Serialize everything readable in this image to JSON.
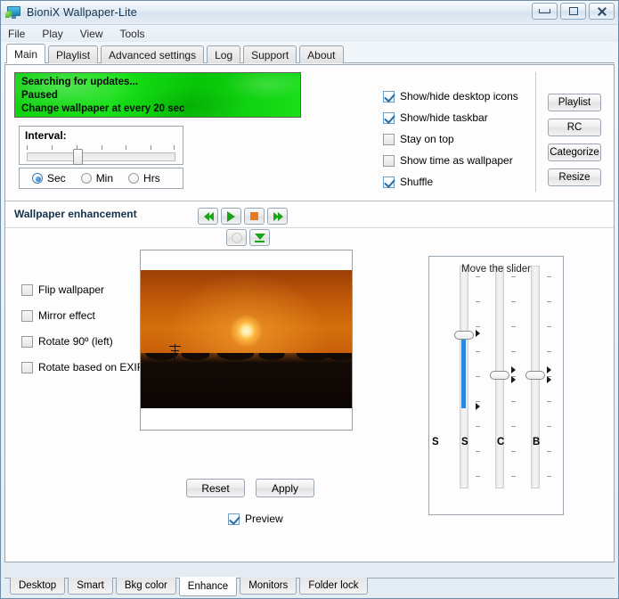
{
  "window": {
    "title": "BioniX Wallpaper-Lite",
    "icon": "monitor-leaf-icon",
    "controls": {
      "minimize": "minimize-icon",
      "maximize": "restore-icon",
      "close": "close-icon"
    }
  },
  "menu": {
    "items": [
      {
        "label": "File"
      },
      {
        "label": "Play"
      },
      {
        "label": "View"
      },
      {
        "label": "Tools"
      }
    ]
  },
  "top_tabs": {
    "active": "Main",
    "items": [
      {
        "label": "Main"
      },
      {
        "label": "Playlist"
      },
      {
        "label": "Advanced settings"
      },
      {
        "label": "Log"
      },
      {
        "label": "Support"
      },
      {
        "label": "About"
      }
    ]
  },
  "status_panel": {
    "color": "#12d612",
    "lines": [
      "Searching for updates...",
      "Paused",
      "Change wallpaper at every 20 sec"
    ]
  },
  "interval": {
    "label": "Interval:",
    "slider_value_percent": 31,
    "tick_count": 7,
    "units": [
      {
        "label": "Sec",
        "selected": true
      },
      {
        "label": "Min",
        "selected": false
      },
      {
        "label": "Hrs",
        "selected": false
      }
    ]
  },
  "playback": {
    "buttons": [
      {
        "name": "previous-button",
        "icon": "rewind-icon"
      },
      {
        "name": "play-button",
        "icon": "play-icon"
      },
      {
        "name": "stop-button",
        "icon": "stop-icon"
      },
      {
        "name": "next-button",
        "icon": "fast-forward-icon"
      },
      {
        "name": "record-button",
        "icon": "circle-icon"
      },
      {
        "name": "download-button",
        "icon": "arrow-down-icon"
      }
    ]
  },
  "options": {
    "checkboxes": [
      {
        "label": "Show/hide desktop icons",
        "checked": true
      },
      {
        "label": "Show/hide taskbar",
        "checked": true
      },
      {
        "label": "Stay on top",
        "checked": false
      },
      {
        "label": "Show time as wallpaper",
        "checked": false
      },
      {
        "label": "Shuffle",
        "checked": true
      }
    ]
  },
  "side_buttons": {
    "items": [
      {
        "label": "Playlist"
      },
      {
        "label": "RC"
      },
      {
        "label": "Categorize"
      },
      {
        "label": "Resize"
      }
    ]
  },
  "enhancement": {
    "title": "Wallpaper enhancement",
    "checkboxes": [
      {
        "label": "Flip wallpaper",
        "checked": false
      },
      {
        "label": "Mirror effect",
        "checked": false
      },
      {
        "label": "Rotate 90º (left)",
        "checked": false
      },
      {
        "label": "Rotate based on EXIF",
        "checked": false
      }
    ],
    "preview_image": "sunset-wallpaper-thumbnail",
    "actions": {
      "reset": "Reset",
      "apply": "Apply"
    },
    "preview_toggle": {
      "label": "Preview",
      "checked": true
    }
  },
  "adjust_panel": {
    "hint": "Move the slider",
    "sliders": [
      {
        "label": "S",
        "name": "saturation-slider",
        "value_percent": 61,
        "filled": true
      },
      {
        "label": "C",
        "name": "contrast-slider",
        "value_percent": 50,
        "filled": false
      },
      {
        "label": "B",
        "name": "brightness-slider",
        "value_percent": 50,
        "filled": false
      }
    ],
    "outer_label": "S"
  },
  "bottom_tabs": {
    "active": "Enhance",
    "items": [
      {
        "label": "Desktop"
      },
      {
        "label": "Smart"
      },
      {
        "label": "Bkg color"
      },
      {
        "label": "Enhance"
      },
      {
        "label": "Monitors"
      },
      {
        "label": "Folder lock"
      }
    ]
  }
}
